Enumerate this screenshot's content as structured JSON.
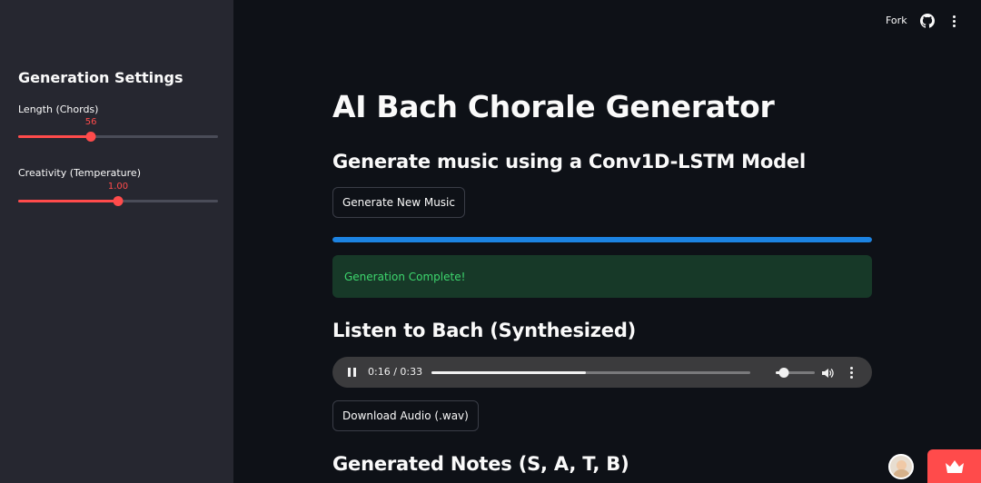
{
  "colors": {
    "background": "#0e1117",
    "sidebar": "#262730",
    "accent": "#ff4b4b",
    "progress": "#1c83e1",
    "success_bg": "#173928",
    "success_text": "#3dd56d"
  },
  "topbar": {
    "fork_label": "Fork",
    "github_icon": "github-icon",
    "menu_icon": "vertical-dots-icon"
  },
  "sidebar": {
    "title": "Generation Settings",
    "sliders": [
      {
        "label": "Length (Chords)",
        "value": "56",
        "fraction": 0.364
      },
      {
        "label": "Creativity (Temperature)",
        "value": "1.00",
        "fraction": 0.5
      }
    ]
  },
  "main": {
    "title": "AI Bach Chorale Generator",
    "subtitle": "Generate music using a Conv1D-LSTM Model",
    "generate_button": "Generate New Music",
    "progress_fraction": 1.0,
    "success_message": "Generation Complete!",
    "listen_header": "Listen to Bach (Synthesized)",
    "audio": {
      "time": "0:16 / 0:33",
      "progress_fraction": 0.485,
      "volume_fraction": 0.2,
      "state": "playing"
    },
    "download_button": "Download Audio (.wav)",
    "notes_header": "Generated Notes (S, A, T, B)"
  },
  "widgets": {
    "avatar_icon": "user-avatar",
    "badge_icon": "crown-icon"
  }
}
